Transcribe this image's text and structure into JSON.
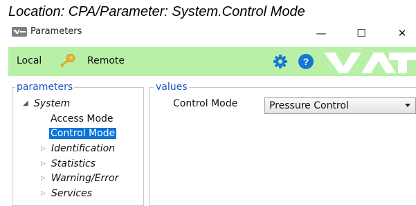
{
  "caption": "Location: CPA/Parameter: System.Control Mode",
  "window": {
    "title": "Parameters",
    "minimize_label": "—",
    "maximize_label": "☐",
    "close_label": "✕"
  },
  "toolbar": {
    "local_label": "Local",
    "remote_label": "Remote",
    "help_label": "?",
    "background_color": "#b8f0a7",
    "accent_color": "#1577d1"
  },
  "parameters_panel": {
    "title": "parameters",
    "tree": {
      "system_label": "System",
      "system_children": [
        "Access Mode",
        "Control Mode"
      ],
      "selected": "Control Mode",
      "groups": [
        "Identification",
        "Statistics",
        "Warning/Error",
        "Services"
      ]
    }
  },
  "values_panel": {
    "title": "values",
    "field_label": "Control Mode",
    "field_value": "Pressure Control"
  },
  "icons": [
    "app-logo-icon",
    "key-icon",
    "gear-icon",
    "help-icon",
    "vat-logo"
  ],
  "logo_text": "VAT"
}
